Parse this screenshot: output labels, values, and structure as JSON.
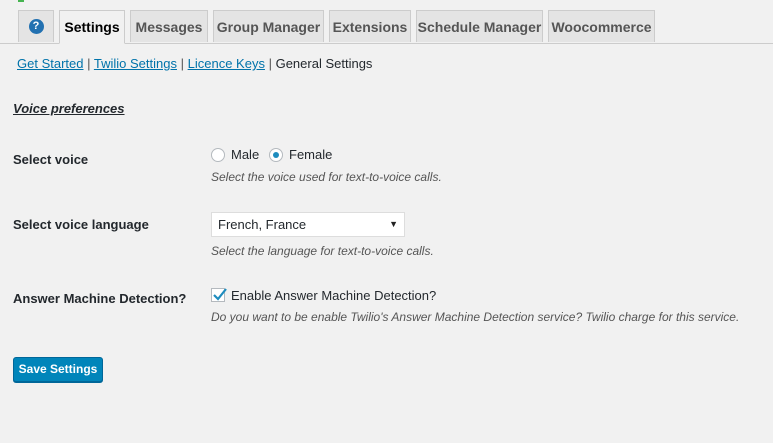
{
  "tabs": {
    "help_glyph": "?",
    "items": [
      {
        "label": "Settings"
      },
      {
        "label": "Messages"
      },
      {
        "label": "Group Manager"
      },
      {
        "label": "Extensions"
      },
      {
        "label": "Schedule Manager"
      },
      {
        "label": "Woocommerce"
      }
    ],
    "active": "Settings"
  },
  "subnav": {
    "links": [
      "Get Started",
      "Twilio Settings",
      "Licence Keys"
    ],
    "current": "General Settings",
    "separator": "|"
  },
  "section": {
    "title": "Voice preferences"
  },
  "voice": {
    "label": "Select voice",
    "options": [
      "Male",
      "Female"
    ],
    "selected": "Female",
    "description": "Select the voice used for text-to-voice calls."
  },
  "language": {
    "label": "Select voice language",
    "value": "French, France",
    "description": "Select the language for text-to-voice calls."
  },
  "amd": {
    "label": "Answer Machine Detection?",
    "checkbox_label": "Enable Answer Machine Detection?",
    "checked": true,
    "description": "Do you want to be enable Twilio's Answer Machine Detection service? Twilio charge for this service."
  },
  "actions": {
    "save_label": "Save Settings"
  },
  "colors": {
    "primary_button": "#0085ba",
    "link": "#0073aa",
    "background": "#f1f1f1"
  }
}
